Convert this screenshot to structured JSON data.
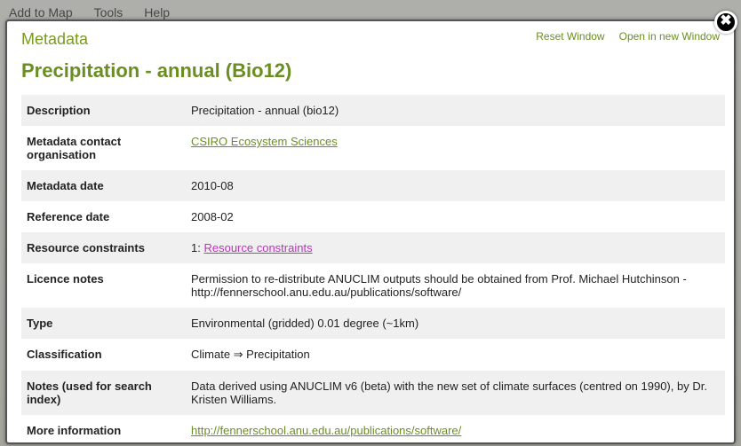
{
  "backgroundMenu": {
    "addToMap": "Add to Map",
    "tools": "Tools",
    "help": "Help"
  },
  "dialog": {
    "title": "Metadata",
    "actions": {
      "reset": "Reset Window",
      "openNew": "Open in new Window"
    },
    "pageHeading": "Precipitation - annual (Bio12)"
  },
  "rows": {
    "description": {
      "label": "Description",
      "value": "Precipitation - annual (bio12)"
    },
    "contactOrg": {
      "label": "Metadata contact organisation",
      "link": "CSIRO Ecosystem Sciences"
    },
    "metadataDate": {
      "label": "Metadata date",
      "value": "2010-08"
    },
    "referenceDate": {
      "label": "Reference date",
      "value": "2008-02"
    },
    "resourceConstraints": {
      "label": "Resource constraints",
      "prefix": "1: ",
      "link": "Resource constraints"
    },
    "licenceNotes": {
      "label": "Licence notes",
      "value": "Permission to re-distribute ANUCLIM outputs should be obtained from Prof. Michael Hutchinson - http://fennerschool.anu.edu.au/publications/software/"
    },
    "type": {
      "label": "Type",
      "value": "Environmental (gridded) 0.01 degree (~1km)"
    },
    "classification": {
      "label": "Classification",
      "value": "Climate ⇒ Precipitation"
    },
    "notes": {
      "label": "Notes (used for search index)",
      "value": "Data derived using ANUCLIM v6 (beta) with the new set of climate surfaces (centred on 1990), by Dr. Kristen Williams."
    },
    "moreInfo": {
      "label": "More information",
      "link": "http://fennerschool.anu.edu.au/publications/software/"
    }
  }
}
